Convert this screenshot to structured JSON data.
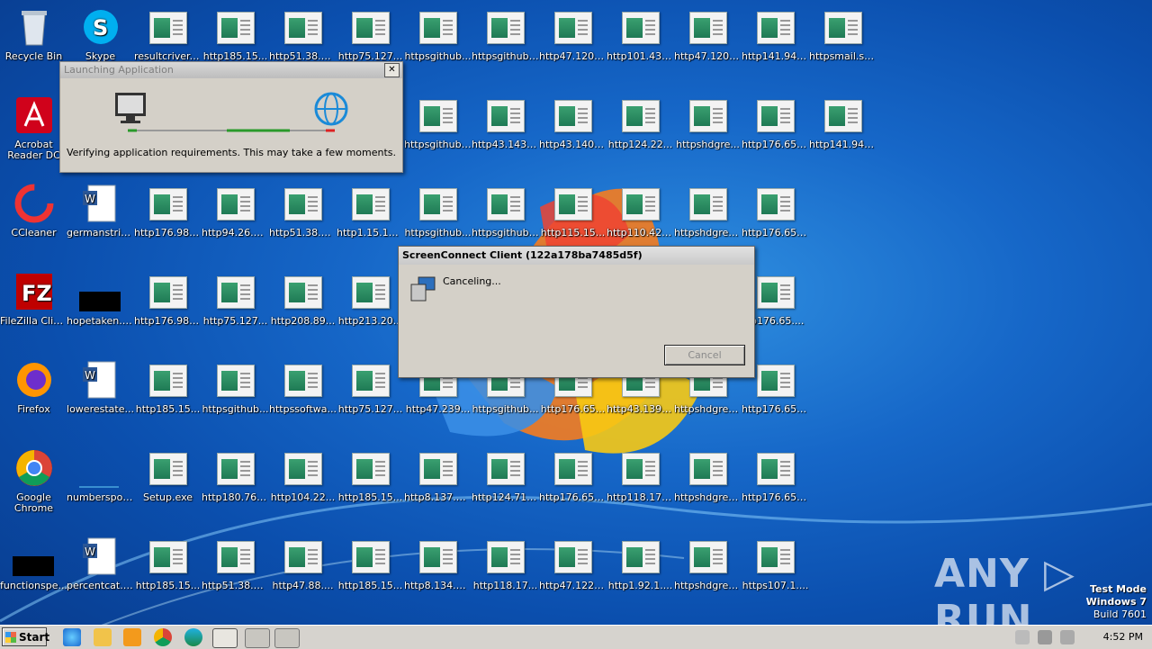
{
  "desktop": {
    "col1": [
      {
        "label": "Recycle Bin",
        "icon": "recycle-bin-icon"
      },
      {
        "label": "Acrobat Reader DC",
        "icon": "acrobat-icon"
      },
      {
        "label": "CCleaner",
        "icon": "ccleaner-icon"
      },
      {
        "label": "FileZilla Client",
        "icon": "filezilla-icon"
      },
      {
        "label": "Firefox",
        "icon": "firefox-icon"
      },
      {
        "label": "Google Chrome",
        "icon": "chrome-icon"
      },
      {
        "label": "functionspe...",
        "icon": "black-file-icon"
      }
    ],
    "col2": [
      {
        "label": "Skype",
        "icon": "skype-icon"
      },
      {
        "label": "germanstrin...",
        "icon": "word-doc-icon"
      },
      {
        "label": "hopetaken.jpg",
        "icon": "black-image-icon"
      },
      {
        "label": "lowerestate...",
        "icon": "word-doc-icon"
      },
      {
        "label": "numberspol...",
        "icon": "blank-file-icon"
      },
      {
        "label": "percentcat.rtf",
        "icon": "word-doc-icon"
      }
    ],
    "grid": [
      [
        "resultcriver.rtf",
        "http185.15...",
        "http51.38.1...",
        "http75.127...",
        "httpsgithub...",
        "httpsgithub....",
        "http47.120....",
        "http101.43....",
        "http47.120....",
        "http141.94....",
        "httpsmail.sc..."
      ],
      [
        "",
        "",
        "",
        "",
        "httpsgithub....",
        "http43.143....",
        "http43.140....",
        "http124.22...",
        "httpshdgre...",
        "http176.65....",
        "http141.94...."
      ],
      [
        "http176.98....",
        "http94.26.9...",
        "http51.38.1...",
        "http1.15.17...",
        "httpsgithub...",
        "httpsgithub....",
        "http115.15...",
        "http110.42....",
        "httpshdgree...",
        "http176.65....",
        ""
      ],
      [
        "http176.98....",
        "http75.127...",
        "http208.89...",
        "http213.20...",
        "",
        "",
        "",
        "",
        "",
        "tp176.65....",
        ""
      ],
      [
        "http185.15...",
        "httpsgithub...",
        "httpssoftwa...",
        "http75.127...",
        "http47.239...",
        "httpsgithub...",
        "http176.65...",
        "http43.139....",
        "httpshdgree...",
        "http176.65....",
        ""
      ],
      [
        "Setup.exe",
        "http180.76....",
        "http104.22...",
        "http185.15...",
        "http8.137.6...",
        "http124.71....",
        "http176.65....",
        "http118.17....",
        "httpshdgree...",
        "http176.65....",
        ""
      ],
      [
        "http185.15...",
        "http51.38.1...",
        "http47.88....",
        "http185.15...",
        "http8.134.8...",
        "http118.17...",
        "http47.122....",
        "http1.92.1....",
        "httpshdgree...",
        "https107.1....",
        ""
      ]
    ]
  },
  "launch_dialog": {
    "title": "Launching Application",
    "message": "Verifying application requirements. This may take a few moments.",
    "close": "✕"
  },
  "sc_dialog": {
    "title": "ScreenConnect Client (122a178ba7485d5f)",
    "status": "Canceling...",
    "cancel_label": "Cancel"
  },
  "taskbar": {
    "start_label": "Start",
    "clock": "4:52 PM"
  },
  "watermark": "ANY ▷ RUN",
  "test_mode": {
    "line1": "Test Mode",
    "line2": "Windows 7",
    "line3": "Build 7601"
  }
}
